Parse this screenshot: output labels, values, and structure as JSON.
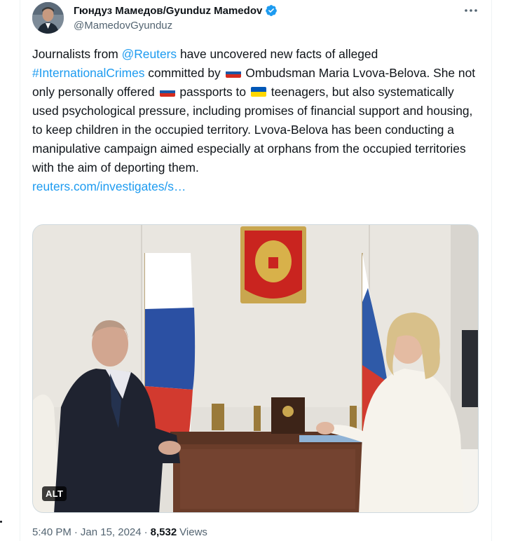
{
  "author": {
    "display_name": "Гюндуз Мамедов/Gyunduz Mamedov",
    "handle": "@MamedovGyunduz",
    "verified": true
  },
  "tweet": {
    "seg_1": "Journalists from ",
    "mention": "@Reuters",
    "seg_2": " have uncovered new facts of alleged ",
    "hashtag": "#InternationalCrimes",
    "seg_3": " committed by ",
    "seg_4": " Ombudsman Maria Lvova-Belova. She not only personally offered ",
    "seg_5": " passports to ",
    "seg_6": " teenagers, but also systematically used psychological pressure, including promises of financial support and housing, to keep children in the occupied territory. Lvova-Belova has been conducting a manipulative campaign aimed especially at orphans from the occupied territories with the aim of deporting them.",
    "link": "reuters.com/investigates/s…"
  },
  "media": {
    "alt_label": "ALT"
  },
  "meta": {
    "time": "5:40 PM",
    "separator_1": "·",
    "date": "Jan 15, 2024",
    "separator_2": "·",
    "views_count": "8,532",
    "views_label": "Views"
  },
  "colors": {
    "link": "#1d9bf0",
    "text": "#0f1419",
    "secondary": "#536471",
    "border": "#cfd9de"
  }
}
